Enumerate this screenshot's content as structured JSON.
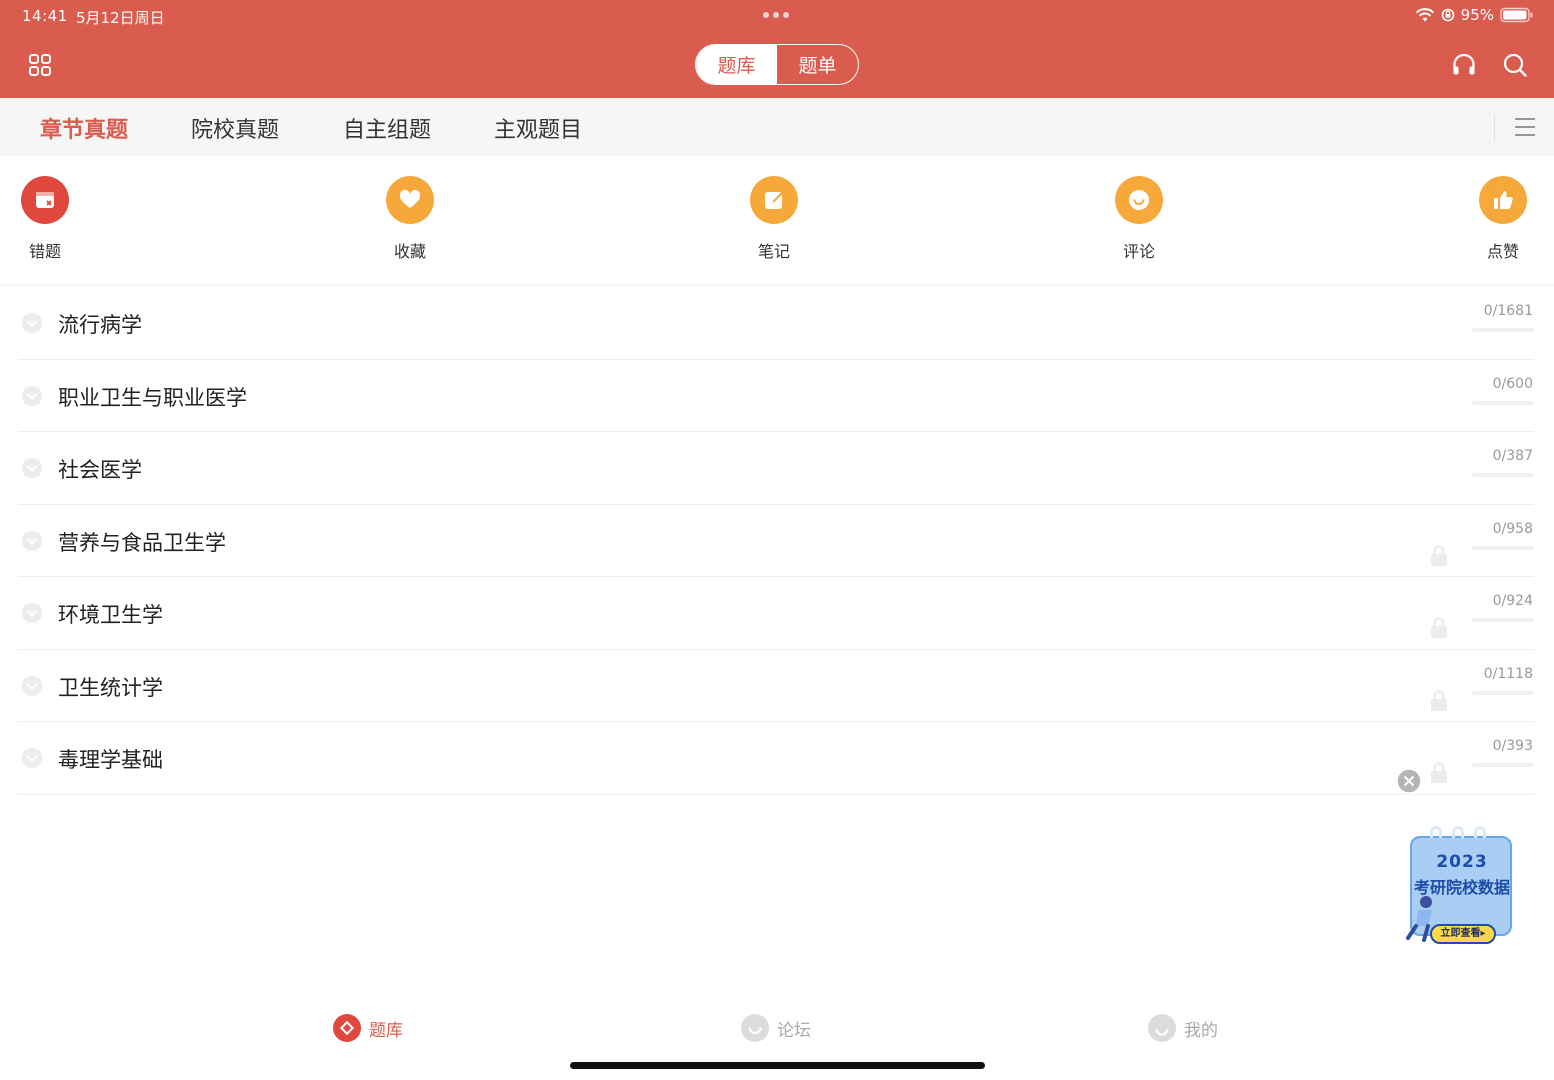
{
  "status_bar": {
    "time": "14:41",
    "date": "5月12日周日",
    "battery": "95%"
  },
  "header": {
    "segments": [
      {
        "label": "题库",
        "active": true
      },
      {
        "label": "题单",
        "active": false
      }
    ]
  },
  "tabs": [
    {
      "label": "章节真题",
      "active": true
    },
    {
      "label": "院校真题",
      "active": false
    },
    {
      "label": "自主组题",
      "active": false
    },
    {
      "label": "主观题目",
      "active": false
    }
  ],
  "quick_actions": [
    {
      "label": "错题",
      "icon": "wrong-questions-icon",
      "color": "#e1483d"
    },
    {
      "label": "收藏",
      "icon": "favorite-heart-icon",
      "color": "#f6a93a"
    },
    {
      "label": "笔记",
      "icon": "note-edit-icon",
      "color": "#f6a93a"
    },
    {
      "label": "评论",
      "icon": "comment-smile-icon",
      "color": "#f6a93a"
    },
    {
      "label": "点赞",
      "icon": "thumbs-up-icon",
      "color": "#f6a93a"
    }
  ],
  "chapters": [
    {
      "title": "流行病学",
      "count": "0/1681",
      "locked": false,
      "progress": 0
    },
    {
      "title": "职业卫生与职业医学",
      "count": "0/600",
      "locked": false,
      "progress": 0
    },
    {
      "title": "社会医学",
      "count": "0/387",
      "locked": false,
      "progress": 0
    },
    {
      "title": "营养与食品卫生学",
      "count": "0/958",
      "locked": true,
      "progress": 0
    },
    {
      "title": "环境卫生学",
      "count": "0/924",
      "locked": true,
      "progress": 0
    },
    {
      "title": "卫生统计学",
      "count": "0/1118",
      "locked": true,
      "progress": 0
    },
    {
      "title": "毒理学基础",
      "count": "0/393",
      "locked": true,
      "progress": 0
    }
  ],
  "ad": {
    "year": "2023",
    "title": "考研院校数据",
    "button": "立即查看▸"
  },
  "bottom_nav": [
    {
      "label": "题库",
      "active": true,
      "icon": "question-bank-icon"
    },
    {
      "label": "论坛",
      "active": false,
      "icon": "forum-icon"
    },
    {
      "label": "我的",
      "active": false,
      "icon": "profile-icon"
    }
  ],
  "colors": {
    "brand": "#d95c4f",
    "accent_orange": "#f6a93a",
    "muted": "#999999"
  }
}
